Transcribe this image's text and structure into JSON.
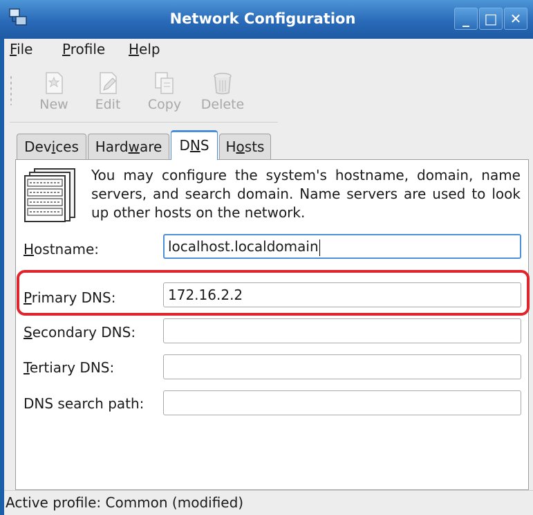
{
  "window": {
    "title": "Network Configuration"
  },
  "titlebar": {
    "minimize_glyph": "_",
    "maximize_glyph": "□",
    "close_glyph": "✕"
  },
  "menu": {
    "file": {
      "u": "F",
      "rest": "ile"
    },
    "profile": {
      "u": "P",
      "rest": "rofile"
    },
    "help": {
      "u": "H",
      "rest": "elp"
    }
  },
  "toolbar": {
    "new_label": "New",
    "edit_label": "Edit",
    "copy_label": "Copy",
    "delete_label": "Delete"
  },
  "tabs": {
    "devices": {
      "pre": "Dev",
      "u": "i",
      "post": "ces"
    },
    "hardware": {
      "pre": "Hard",
      "u": "w",
      "post": "are"
    },
    "dns": {
      "pre": "D",
      "u": "N",
      "post": "S"
    },
    "hosts": {
      "pre": "H",
      "u": "o",
      "post": "sts"
    }
  },
  "dns_page": {
    "description": "You may configure the system's hostname, domain, name servers, and search domain. Name servers are used to look up other hosts on the network.",
    "fields": {
      "hostname": {
        "label_u": "H",
        "label_rest": "ostname:",
        "value": "localhost.localdomain"
      },
      "primary": {
        "label_u": "P",
        "label_rest": "rimary DNS:",
        "value": "172.16.2.2"
      },
      "secondary": {
        "label_u": "S",
        "label_rest": "econdary DNS:",
        "value": ""
      },
      "tertiary": {
        "label_u": "T",
        "label_rest": "ertiary DNS:",
        "value": ""
      },
      "search": {
        "label": "DNS search path:",
        "value": ""
      }
    }
  },
  "status": {
    "text": "Active profile: Common (modified)"
  },
  "colors": {
    "titlebar": "#2a6ab8",
    "highlight": "#e0242b",
    "focus": "#4a90d9"
  },
  "icons": [
    "network-config-app-icon",
    "new-icon",
    "edit-icon",
    "copy-icon",
    "delete-icon",
    "dns-list-icon"
  ]
}
